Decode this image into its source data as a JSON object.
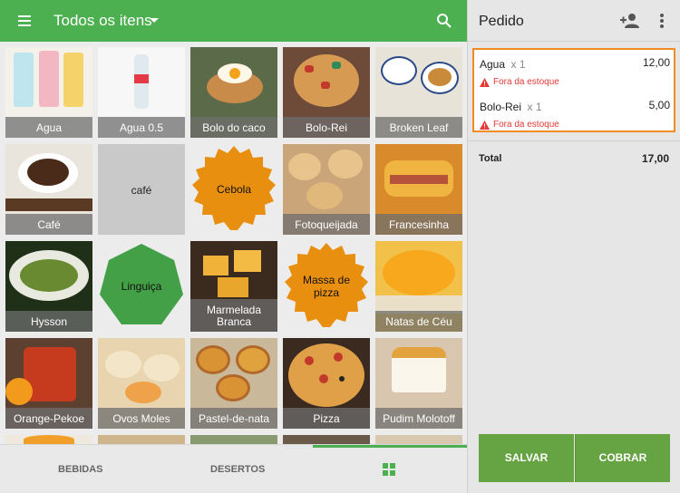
{
  "header": {
    "title": "Todos os itens"
  },
  "items": [
    {
      "label": "Agua"
    },
    {
      "label": "Agua 0.5"
    },
    {
      "label": "Bolo do caco"
    },
    {
      "label": "Bolo-Rei"
    },
    {
      "label": "Broken Leaf"
    },
    {
      "label": "Café"
    },
    {
      "label": "café"
    },
    {
      "label": "Cebola"
    },
    {
      "label": "Fotoqueijada"
    },
    {
      "label": "Francesinha"
    },
    {
      "label": "Hysson"
    },
    {
      "label": "Linguiça"
    },
    {
      "label": "Marmelada Branca"
    },
    {
      "label": "Massa de pizza"
    },
    {
      "label": "Natas de Céu"
    },
    {
      "label": "Orange-Pekoe"
    },
    {
      "label": "Ovos Moles"
    },
    {
      "label": "Pastel-de-nata"
    },
    {
      "label": "Pizza"
    },
    {
      "label": "Pudim Molotoff"
    }
  ],
  "tabs": {
    "bebidas": "BEBIDAS",
    "desertos": "DESERTOS"
  },
  "order": {
    "title": "Pedido",
    "lines": [
      {
        "name": "Agua",
        "qty": "x 1",
        "price": "12,00",
        "warning": "Fora da estoque"
      },
      {
        "name": "Bolo-Rei",
        "qty": "x 1",
        "price": "5,00",
        "warning": "Fora da estoque"
      }
    ],
    "total_label": "Total",
    "total_value": "17,00",
    "save_label": "SALVAR",
    "charge_label": "COBRAR"
  },
  "colors": {
    "accent": "#4caf50",
    "orange": "#e88f0f",
    "warning": "#e53935",
    "highlight": "#f08a24"
  }
}
